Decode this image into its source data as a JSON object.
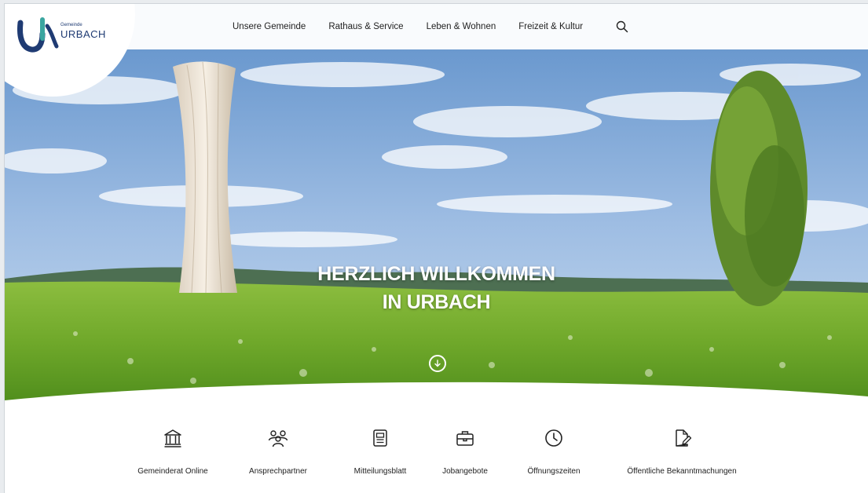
{
  "header": {
    "logo": {
      "small_text": "Gemeinde",
      "big_text": "URBACH"
    },
    "nav": [
      {
        "label": "Unsere Gemeinde"
      },
      {
        "label": "Rathaus & Service"
      },
      {
        "label": "Leben & Wohnen"
      },
      {
        "label": "Freizeit & Kultur"
      }
    ],
    "search_icon": "search-icon"
  },
  "hero": {
    "title_line1": "HERZLICH WILLKOMMEN",
    "title_line2": "IN URBACH",
    "scroll_icon": "arrow-down-circle-icon"
  },
  "quick_links": [
    {
      "label": "Gemeinderat Online",
      "icon": "building-icon"
    },
    {
      "label": "Ansprechpartner",
      "icon": "people-icon"
    },
    {
      "label": "Mitteilungsblatt",
      "icon": "newspaper-icon"
    },
    {
      "label": "Jobangebote",
      "icon": "briefcase-icon"
    },
    {
      "label": "Öffnungszeiten",
      "icon": "clock-icon"
    },
    {
      "label": "Öffentliche Bekanntmachungen",
      "icon": "document-pen-icon"
    }
  ],
  "colors": {
    "brand_navy": "#1f3b73",
    "brand_teal": "#3aa6a0",
    "text": "#222222"
  }
}
